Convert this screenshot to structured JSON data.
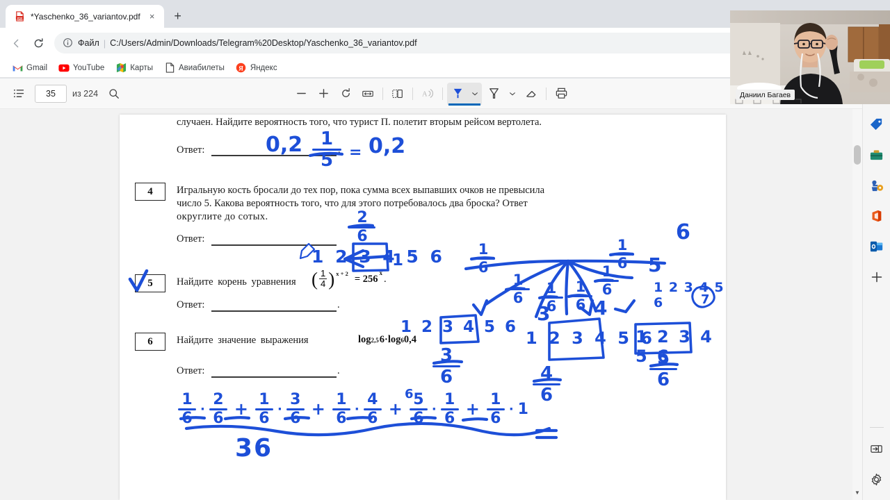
{
  "browser": {
    "tab": {
      "title": "*Yaschenko_36_variantov.pdf",
      "favicon": "pdf-file-icon",
      "close": "×"
    },
    "newtab_label": "+",
    "nav": {
      "back": "←",
      "reload": "⟳"
    },
    "omnibox": {
      "info_icon": "info-circle-icon",
      "scheme_label": "Файл",
      "separator": "|",
      "url": "C:/Users/Admin/Downloads/Telegram%20Desktop/Yaschenko_36_variantov.pdf",
      "zoom_icon": "zoom-in-icon",
      "favorite_icon": "star-add-icon"
    },
    "bookmarks": [
      {
        "label": "Gmail",
        "icon": "gmail-icon"
      },
      {
        "label": "YouTube",
        "icon": "youtube-icon"
      },
      {
        "label": "Карты",
        "icon": "google-maps-icon"
      },
      {
        "label": "Авиабилеты",
        "icon": "document-icon"
      },
      {
        "label": "Яндекс",
        "icon": "yandex-icon"
      }
    ]
  },
  "pdf_toolbar": {
    "sidebar_toggle": "table-of-contents-icon",
    "page_current": "35",
    "page_total": "из 224",
    "search_icon": "search-icon",
    "zoom_out": "−",
    "zoom_in": "+",
    "rotate": "rotate-icon",
    "fit_width": "fit-width-icon",
    "page_view": "page-view-icon",
    "read_aloud": "read-aloud-icon",
    "draw": "draw-pen-icon",
    "draw_chevron": "chevron-down-icon",
    "highlight": "highlighter-icon",
    "highlight_chevron": "chevron-down-icon",
    "erase": "eraser-icon",
    "print": "print-icon"
  },
  "document": {
    "line_top": "случаен. Найдите вероятность того, что турист П. полетит вторым рейсом вертолета.",
    "answer_label": "Ответ:",
    "tasks": [
      {
        "number": "4",
        "lines": [
          "Игральную кость бросали до тех пор, пока сумма всех выпавших очков не превысила",
          "число 5. Какова вероятность того, что для этого потребовалось два броска? Ответ",
          "округлите до сотых."
        ],
        "answer_label": "Ответ:"
      },
      {
        "number": "5",
        "check": "✓",
        "text_before": "Найдите корень уравнения",
        "frac_num": "1",
        "frac_den": "4",
        "exponent": "x + 2",
        "text_after": "= 256",
        "rhs_exp": "x",
        "period": ".",
        "answer_label": "Ответ:"
      },
      {
        "number": "6",
        "text_before": "Найдите значение выражения",
        "expression": "log",
        "sub1": "2,5",
        "mid": "6·log",
        "sub2": "6",
        "tail": "0,4",
        "answer_label": "Ответ:"
      }
    ]
  },
  "annotations": {
    "answer3": "0,2",
    "eq_top": {
      "num": "1",
      "den": "5",
      "equals": "=",
      "result": "0,2"
    },
    "task4_frac": {
      "num": "2",
      "den": "6"
    },
    "dice_sets": [
      {
        "label": "1 2 3 4 5 6",
        "boxed_from": 4
      },
      {
        "label": "1 2 3 4 5 6",
        "boxed_from": 3
      },
      {
        "label": "1 2 3 4 5 6",
        "boxed_from": 2
      },
      {
        "label": "1 2 3 4 5 6",
        "boxed_from": 1
      }
    ],
    "tree_probability": "1/6",
    "tree_branch_labels": [
      "1",
      "2",
      "3",
      "4",
      "5",
      "6"
    ],
    "tree_fracs": [
      "1",
      "6"
    ],
    "circled_seven": "7",
    "branch_numbers": [
      "1",
      "3",
      "4",
      "5",
      "6"
    ],
    "result_fracs": [
      {
        "num": "3",
        "den": "6"
      },
      {
        "num": "4",
        "den": "6"
      },
      {
        "num": "5",
        "den": "6"
      }
    ],
    "bottom_sum": {
      "terms": [
        {
          "a_n": "1",
          "a_d": "6",
          "b_n": "2",
          "b_d": "6"
        },
        {
          "a_n": "1",
          "a_d": "6",
          "b_n": "3",
          "b_d": "6"
        },
        {
          "a_n": "1",
          "a_d": "6",
          "b_n": "4",
          "b_d": "6"
        },
        {
          "a_n": "5",
          "a_d": "6",
          "b_n": "1",
          "b_d": "6"
        },
        {
          "a_n": "1",
          "a_d": "6",
          "b_n": "1",
          "b_d": ""
        }
      ],
      "plus": "+",
      "dot": "·",
      "denominator": "36",
      "superscript": "6"
    },
    "equals_sign": "="
  },
  "sidebar": {
    "items": [
      {
        "name": "copilot",
        "icon": "sparkle-icon",
        "glyph": "✦"
      },
      {
        "name": "shopping",
        "icon": "price-tag-icon",
        "glyph": "🏷"
      },
      {
        "name": "tools",
        "icon": "toolbox-icon",
        "glyph": "🧰"
      },
      {
        "name": "games",
        "icon": "games-icon",
        "glyph": "♟"
      },
      {
        "name": "office",
        "icon": "office-icon",
        "glyph": "◆"
      },
      {
        "name": "outlook",
        "icon": "outlook-icon",
        "glyph": "O"
      },
      {
        "name": "add",
        "icon": "plus-icon",
        "glyph": "+"
      }
    ],
    "bottom": [
      {
        "name": "expand-sidebar",
        "icon": "expand-sidebar-icon",
        "glyph": "⇥"
      },
      {
        "name": "settings",
        "icon": "gear-icon",
        "glyph": "⚙"
      }
    ]
  },
  "webcam": {
    "participant_name": "Даниил Багаев"
  }
}
